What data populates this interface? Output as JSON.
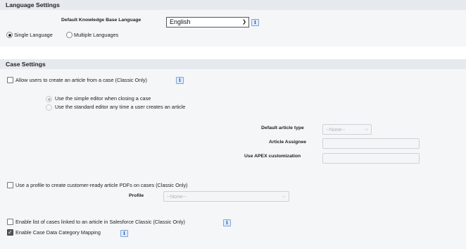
{
  "language_settings": {
    "header": "Language Settings",
    "default_language_label": "Default Knowledge Base Language",
    "default_language_value": "English",
    "info": "i",
    "single_language_label": "Single Language",
    "multiple_languages_label": "Multiple Languages",
    "selected_mode": "single"
  },
  "case_settings": {
    "header": "Case Settings",
    "allow_create_article_label": "Allow users to create an article from a case (Classic Only)",
    "allow_create_article_checked": false,
    "simple_editor_label": "Use the simple editor when closing a case",
    "standard_editor_label": "Use the standard editor any time a user creates an article",
    "default_article_type_label": "Default article type",
    "default_article_type_value": "--None--",
    "article_assignee_label": "Article Assignee",
    "use_apex_label": "Use APEX customization",
    "profile_pdf_label": "Use a profile to create customer-ready article PDFs on cases (Classic Only)",
    "profile_pdf_checked": false,
    "profile_label": "Profile",
    "profile_value": "--None--",
    "enable_list_linked_label": "Enable list of cases linked to an article in Salesforce Classic (Classic Only)",
    "enable_list_linked_checked": false,
    "enable_data_category_label": "Enable Case Data Category Mapping",
    "enable_data_category_checked": true,
    "info": "i"
  }
}
